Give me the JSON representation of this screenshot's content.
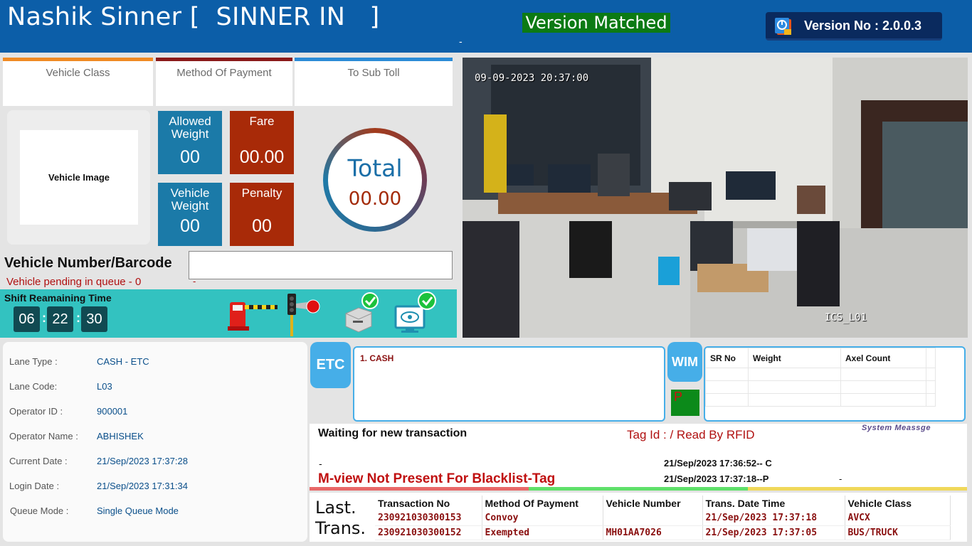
{
  "header": {
    "title": "Nashik Sinner [  SINNER IN   ]",
    "version_status": "Version Matched",
    "dash": "-",
    "version_label": "Version No : 2.0.0.3"
  },
  "cards": {
    "vehicle_class": "Vehicle Class",
    "method_of_payment": "Method Of Payment",
    "to_sub_toll": "To Sub Toll"
  },
  "vehicle_image_label": "Vehicle Image",
  "tiles": {
    "allowed_weight_label": "Allowed Weight",
    "allowed_weight_value": "00",
    "fare_label": "Fare",
    "fare_value": "00.00",
    "vehicle_weight_label": "Vehicle Weight",
    "vehicle_weight_value": "00",
    "penalty_label": "Penalty",
    "penalty_value": "00"
  },
  "total": {
    "label": "Total",
    "value": "00.00"
  },
  "vehicle_number": {
    "label": "Vehicle Number/Barcode",
    "value": ""
  },
  "queue_pending": "Vehicle pending in queue - 0",
  "queue_dash": "-",
  "shift": {
    "label": "Shift Reamaining Time",
    "hours": "06",
    "minutes": "22",
    "seconds": "30",
    "sep": ":"
  },
  "camera": {
    "timestamp": "09-09-2023 20:37:00",
    "label": "ICS_L01"
  },
  "lane_info": [
    {
      "label": "Lane Type :",
      "value": "CASH - ETC"
    },
    {
      "label": "Lane Code:",
      "value": "L03"
    },
    {
      "label": "Operator ID :",
      "value": "900001"
    },
    {
      "label": "Operator Name :",
      "value": "ABHISHEK"
    },
    {
      "label": "Current Date :",
      "value": "21/Sep/2023 17:37:28"
    },
    {
      "label": "Login Date :",
      "value": "21/Sep/2023 17:31:34"
    },
    {
      "label": "Queue Mode :",
      "value": "Single Queue Mode"
    }
  ],
  "etc": {
    "badge": "ETC",
    "items": [
      "1. CASH"
    ]
  },
  "wim": {
    "badge": "WIM",
    "status": "P",
    "columns": [
      "SR No",
      "Weight",
      "Axel Count",
      ""
    ]
  },
  "messages": {
    "waiting": "Waiting for new transaction",
    "tag_id": "Tag Id : / Read By RFID",
    "system": "System Meassge",
    "dash": "-",
    "time1": "21/Sep/2023 17:36:52-- C",
    "time2": "21/Sep/2023 17:37:18--P",
    "dash2": "-",
    "blacklist": "M-view Not Present For Blacklist-Tag"
  },
  "last_trans": {
    "label_line1": "Last.",
    "label_line2": "Trans.",
    "columns": [
      "Transaction No",
      "Method Of Payment",
      "Vehicle Number",
      "Trans. Date Time",
      "Vehicle Class"
    ],
    "rows": [
      [
        "230921030300153",
        "Convoy",
        "",
        "21/Sep/2023 17:37:18",
        "AVCX"
      ],
      [
        "230921030300152",
        "Exempted",
        "MH01AA7026",
        "21/Sep/2023 17:37:05",
        "BUS/TRUCK"
      ]
    ]
  },
  "colors": {
    "header_bg": "#0c5ea8",
    "version_green": "#0c7a14",
    "tile_blue": "#1b7aa8",
    "tile_red": "#a82a08",
    "strip_teal": "#33c2c0",
    "accent_light_blue": "#46aee8"
  },
  "icons": [
    "version-app-icon",
    "boom-barrier-icon",
    "traffic-light-icon",
    "printer-ok-icon",
    "display-ok-icon"
  ]
}
